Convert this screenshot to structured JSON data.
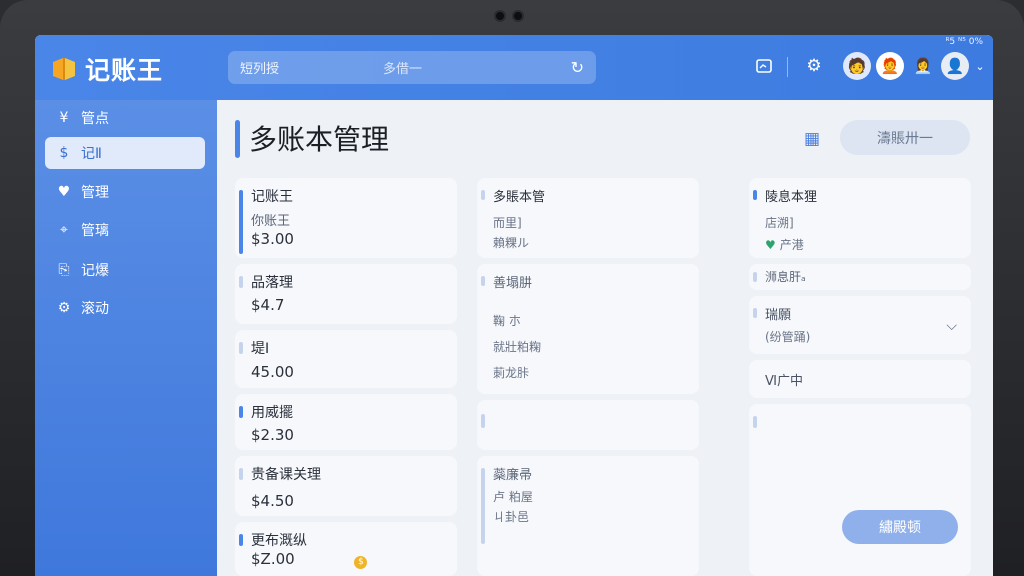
{
  "status_bar": "ᴿ5 ᴺ⁵ 0%",
  "app": {
    "name": "记账王"
  },
  "search": {
    "left_text": "短列授",
    "mid_text": "多借一"
  },
  "sidebar": {
    "items": [
      {
        "icon": "¥",
        "label": "管点"
      },
      {
        "icon": "$",
        "label": "记Ⅱ"
      },
      {
        "icon": "♥",
        "label": "管理"
      },
      {
        "icon": "⌖",
        "label": "管璃"
      },
      {
        "icon": "⎘",
        "label": "记爆"
      },
      {
        "icon": "⚙",
        "label": "滚动"
      }
    ]
  },
  "page": {
    "title": "多账本管理",
    "top_button": "濤賬卅一"
  },
  "column1": {
    "cards": [
      {
        "title": "记账王",
        "sub": "你账王",
        "amount": "$3.00"
      },
      {
        "title": "品落理",
        "amount": "$4.7"
      },
      {
        "title": "堤Ⅰ",
        "amount": "45.00"
      },
      {
        "title": "用威擺",
        "amount": "$2.30"
      },
      {
        "title": "贵备课关理",
        "amount": "$4.50"
      },
      {
        "title": "更布溉纵",
        "amount": "$Z.00"
      }
    ]
  },
  "column2": {
    "cards": [
      {
        "title": "多賬本管",
        "lines": [
          "而里]",
          "賴粿ル"
        ]
      },
      {
        "title": "善塌肼",
        "lines": [
          "鞠 朩",
          "就壯粕粷",
          "莿龙胩"
        ]
      },
      {
        "title": "",
        "lines": []
      },
      {
        "title": "蘂廉帚",
        "lines": [
          "卢 粕屋",
          "ㄐ卦邑"
        ]
      }
    ]
  },
  "column3": {
    "cards": [
      {
        "title": "陵息本狸",
        "lines": [
          "店溯]"
        ],
        "badge": "产港"
      },
      {
        "title": "浉息肝ₐ"
      },
      {
        "title": "瑞願",
        "sub": "(纷管踊)"
      },
      {
        "title": "Ⅵ广中"
      },
      {
        "title": ""
      }
    ]
  },
  "fab": {
    "label": "繡殿顿"
  }
}
